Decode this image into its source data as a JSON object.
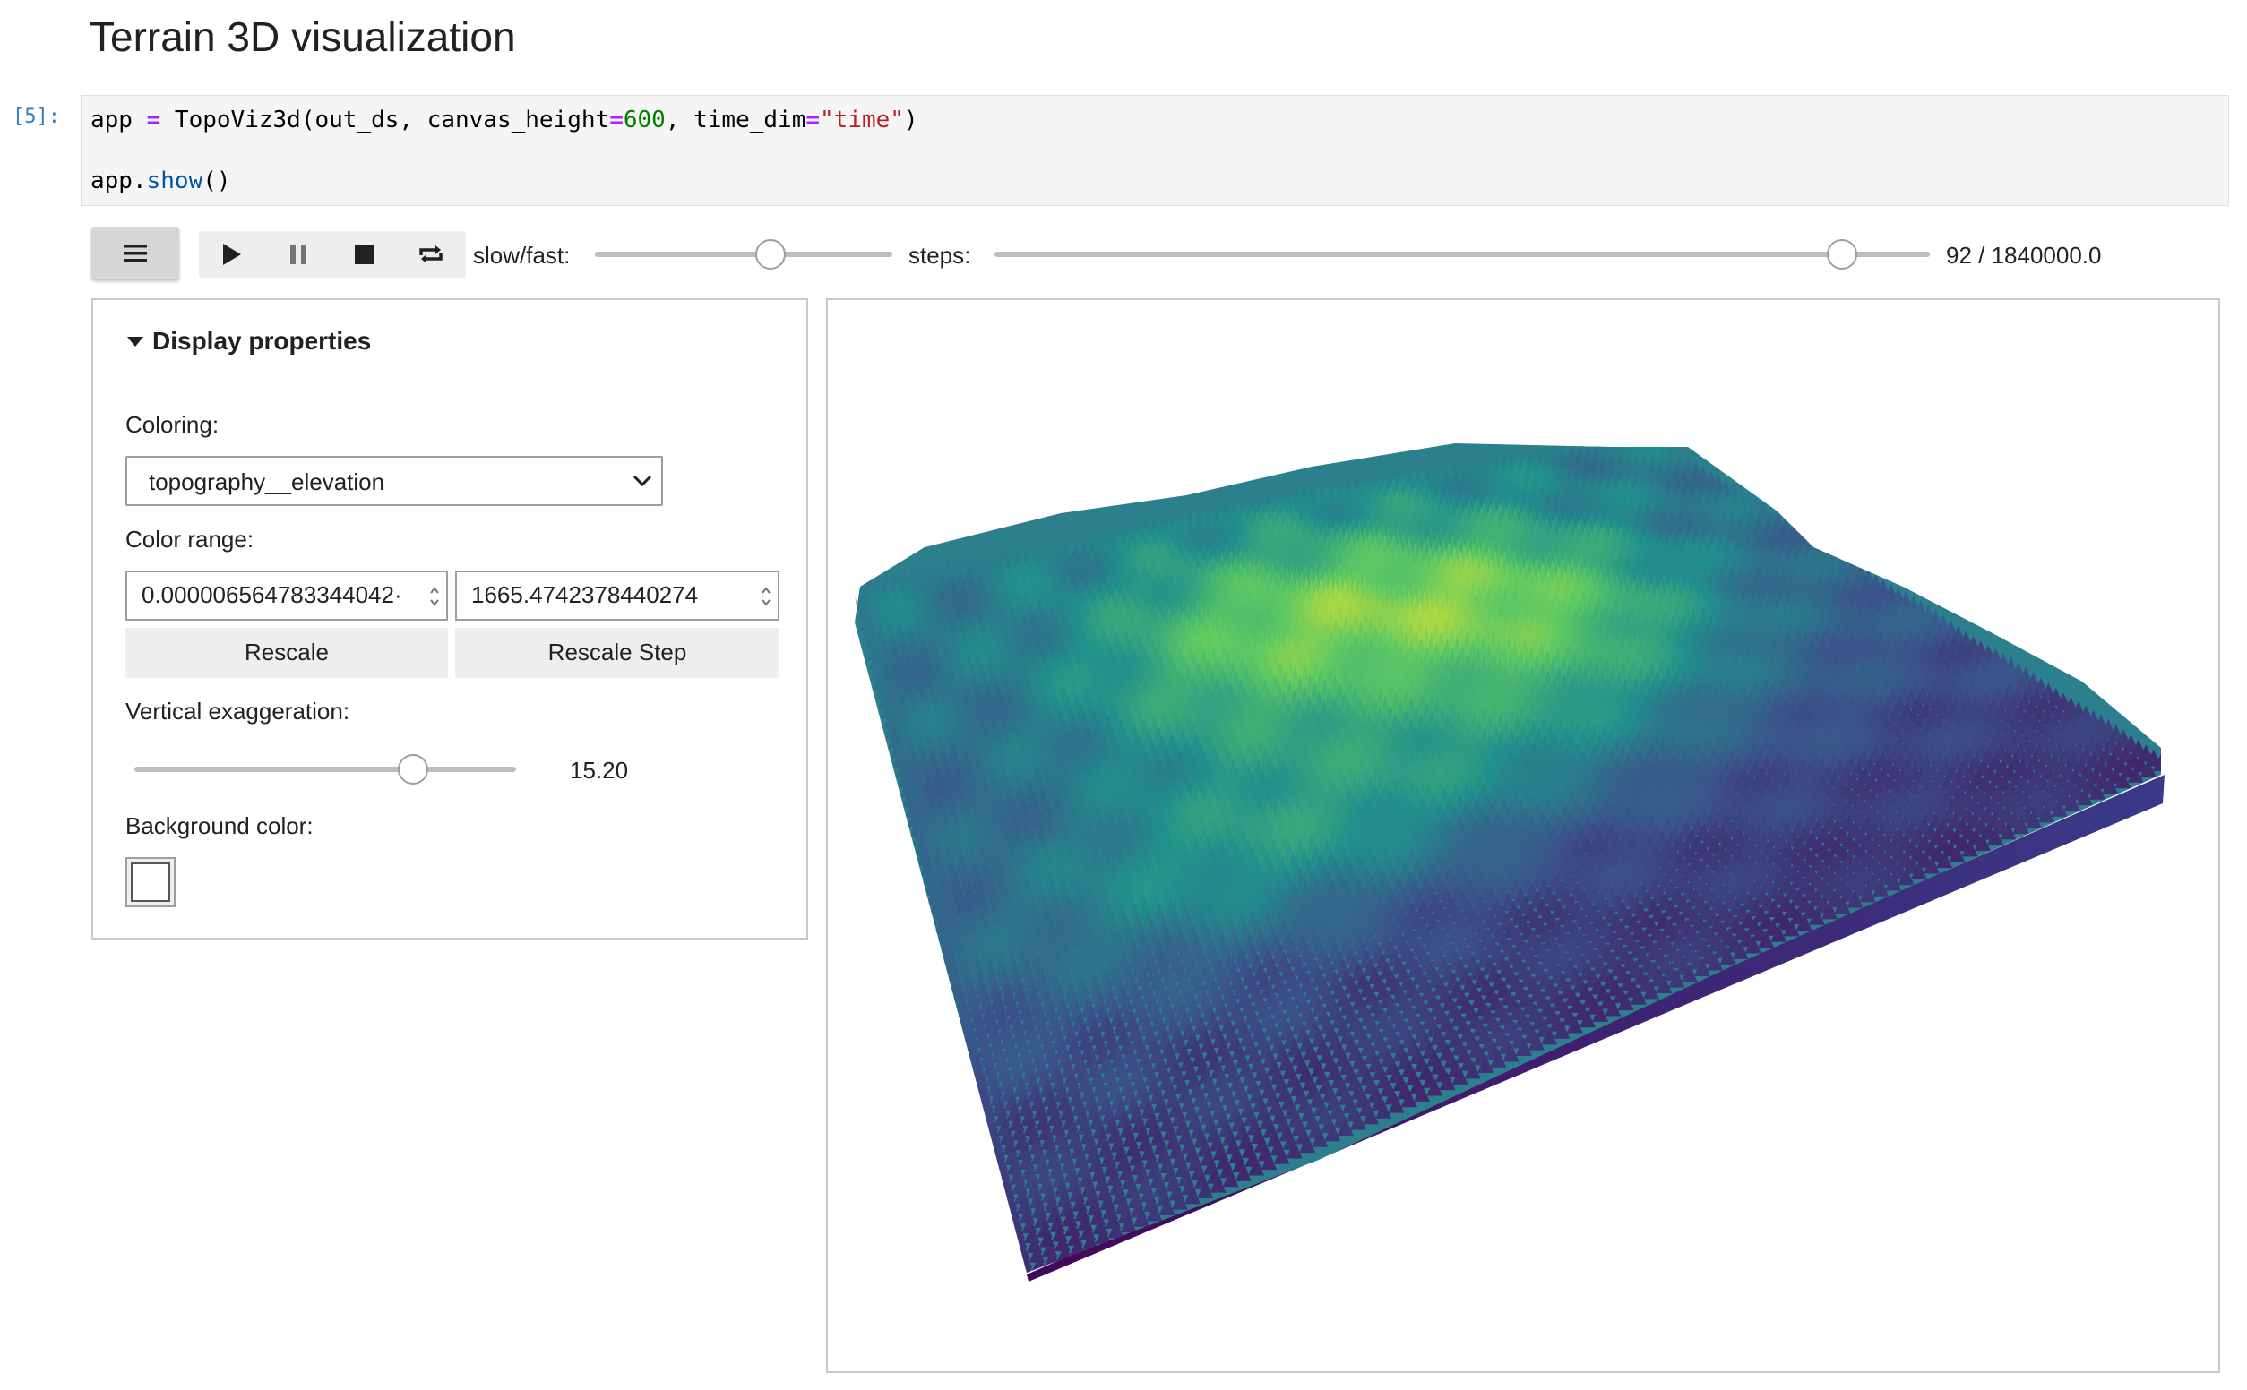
{
  "page": {
    "title": "Terrain 3D visualization"
  },
  "cell": {
    "prompt": "[5]:",
    "line1": {
      "p1": "app ",
      "op1": "=",
      "p2": " TopoViz3d(out_ds, canvas_height",
      "op2": "=",
      "num": "600",
      "p3": ", time_dim",
      "op3": "=",
      "str": "\"time\"",
      "p4": ")"
    },
    "line2": {
      "p1": "app.",
      "fn": "show",
      "p2": "()"
    }
  },
  "toolbar": {
    "menu_icon": "hamburger-icon",
    "play_icon": "play-icon",
    "pause_icon": "pause-icon",
    "stop_icon": "stop-icon",
    "repeat_icon": "repeat-icon",
    "speed_label": "slow/fast:",
    "speed_value": 0.6,
    "steps_label": "steps:",
    "steps_value": 92,
    "steps_max": 1840000,
    "steps_readout": "92 / 1840000.0"
  },
  "panel": {
    "title": "Display properties",
    "toggle_icon": "caret-down-icon",
    "coloring_label": "Coloring:",
    "coloring_value": "topography__elevation",
    "color_range_label": "Color range:",
    "range_min": "0.000006564783344042·",
    "range_max": "1665.4742378440274",
    "rescale": "Rescale",
    "rescale_step": "Rescale Step",
    "exaggeration_label": "Vertical exaggeration:",
    "exaggeration_value": "15.20",
    "exaggeration_fraction": 0.75,
    "background_label": "Background color:",
    "background_color": "#ffffff"
  },
  "canvas": {
    "colormap": [
      "#440154",
      "#3b528b",
      "#21918c",
      "#5ec962",
      "#fde725"
    ]
  }
}
